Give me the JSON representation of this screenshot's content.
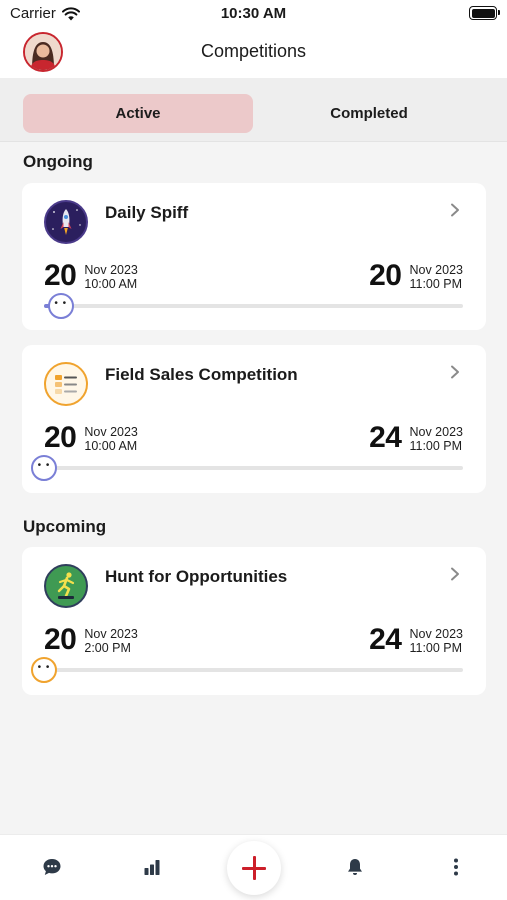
{
  "status_bar": {
    "carrier": "Carrier",
    "time": "10:30 AM"
  },
  "header": {
    "title": "Competitions"
  },
  "tabs": {
    "active": "Active",
    "completed": "Completed"
  },
  "sections": {
    "ongoing": "Ongoing",
    "upcoming": "Upcoming"
  },
  "competitions": [
    {
      "title": "Daily Spiff",
      "icon": "rocket-icon",
      "start": {
        "day": "20",
        "month_year": "Nov 2023",
        "time": "10:00 AM"
      },
      "end": {
        "day": "20",
        "month_year": "Nov 2023",
        "time": "11:00 PM"
      },
      "progress": 0.04,
      "accent": "#7a7fd6"
    },
    {
      "title": "Field Sales Competition",
      "icon": "list-icon",
      "start": {
        "day": "20",
        "month_year": "Nov 2023",
        "time": "10:00 AM"
      },
      "end": {
        "day": "24",
        "month_year": "Nov 2023",
        "time": "11:00 PM"
      },
      "progress": 0.0,
      "accent": "#7a7fd6"
    },
    {
      "title": "Hunt for Opportunities",
      "icon": "runner-icon",
      "start": {
        "day": "20",
        "month_year": "Nov 2023",
        "time": "2:00 PM"
      },
      "end": {
        "day": "24",
        "month_year": "Nov 2023",
        "time": "11:00 PM"
      },
      "progress": 0.0,
      "accent": "#f0a32e"
    }
  ],
  "bottom_nav": {
    "icons": [
      "chat-icon",
      "bar-chart-icon",
      "plus-icon",
      "bell-icon",
      "more-vertical-icon"
    ]
  },
  "colors": {
    "brand_red": "#cc1f2a",
    "active_tab_bg": "#ecc9ca",
    "track_purple": "#7a7fd6",
    "track_orange": "#f0a32e"
  }
}
